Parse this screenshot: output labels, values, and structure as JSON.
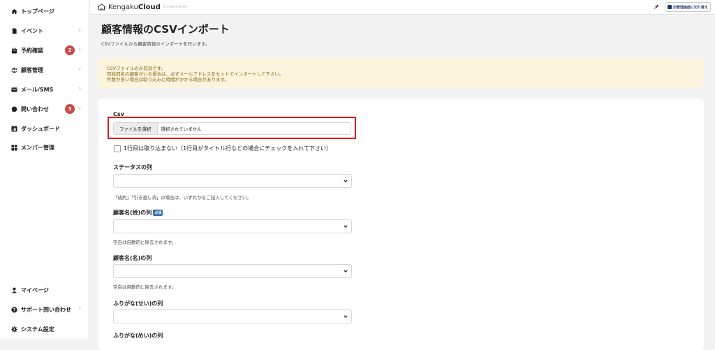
{
  "sidebar": {
    "items": [
      {
        "label": "トップページ"
      },
      {
        "label": "イベント"
      },
      {
        "label": "予約確認",
        "badge": "2"
      },
      {
        "label": "顧客管理"
      },
      {
        "label": "メール/SMS"
      },
      {
        "label": "問い合わせ",
        "badge": "3"
      },
      {
        "label": "ダッシュボード"
      },
      {
        "label": "メンバー管理"
      }
    ],
    "bottom_items": [
      {
        "label": "マイページ"
      },
      {
        "label": "サポート問い合わせ"
      },
      {
        "label": "システム設定"
      }
    ]
  },
  "header": {
    "logo_text": "Kengaku",
    "logo_bold": "Cloud",
    "logo_sub": "ケンガククラウド",
    "switch_label": "旧管理画面に切り替え"
  },
  "page": {
    "title": "顧客情報のCSVインポート",
    "subtitle": "CSVファイルから顧客情報のインポートを行います。"
  },
  "notice": {
    "lines": [
      "CSVファイルのみ有効です。",
      "同姓同名の顧客がいる場合は、必ずメールアドレスをセットでインポートして下さい。",
      "件数が多い場合は取り込みに時間がかかる場合があります。"
    ]
  },
  "form": {
    "csv_label": "Csv",
    "file_button": "ファイルを選択",
    "file_status": "選択されていません",
    "skip_first_row_label": "1行目は取り込まない（1行目がタイトル行などの場合にチェックを入れて下さい）",
    "status_label": "ステータスの列",
    "status_help": "「成約」「引き渡し済」の場合は、いずれかをご記入してください。",
    "last_name_label": "顧客名(姓)の列",
    "required_badge": "必須",
    "last_name_help": "空白は自動的に除去されます。",
    "first_name_label": "顧客名(名)の列",
    "first_name_help": "空白は自動的に除去されます。",
    "kana_last_label": "ふりがな(せい)の列",
    "kana_first_label": "ふりがな(めい)の列"
  },
  "colors": {
    "accent_badge": "#c94a4a",
    "highlight": "#e0151a",
    "notice_bg": "#fcf4dc",
    "notice_text": "#8a6416",
    "required_badge": "#2f6aa8"
  }
}
